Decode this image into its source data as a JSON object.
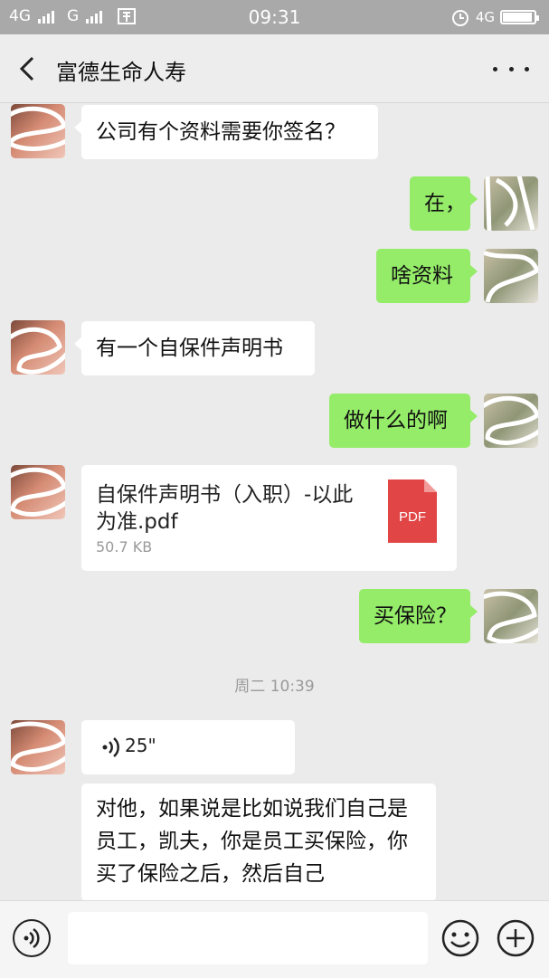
{
  "status_bar": {
    "network1": "4G",
    "network2": "G",
    "time": "09:31",
    "network3": "4G",
    "battery_level": 0.95
  },
  "nav": {
    "title": "富德生命人寿"
  },
  "messages": {
    "m1": "公司有个资料需要你签名？",
    "m2": "在，",
    "m3": "啥资料",
    "m4": "有一个自保件声明书",
    "m5": "做什么的啊",
    "file_name": "自保件声明书（入职）-以此为准.pdf",
    "file_size": "50.7 KB",
    "file_type": "PDF",
    "m6": "买保险？",
    "time_divider": "周二 10:39",
    "voice_length": "25\"",
    "m7": "对他，如果说是比如说我们自己是员工，凯夫，你是员工买保险，你买了保险之后，然后自己"
  },
  "colors": {
    "sent_bubble": "#95ec69",
    "received_bubble": "#ffffff",
    "pdf_red": "#e24545"
  }
}
